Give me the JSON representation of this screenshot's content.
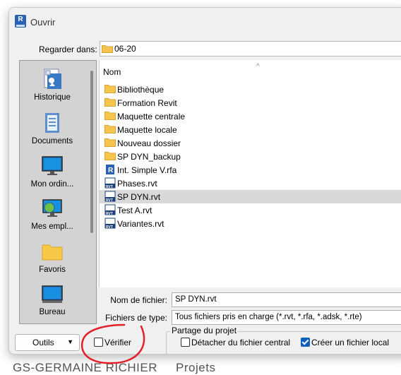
{
  "background": {
    "left_text": "GS-GERMAINE RICHIER",
    "right_text": "Projets"
  },
  "window": {
    "title": "Ouvrir",
    "app_icon_letter": "R"
  },
  "look_in": {
    "label": "Regarder dans:",
    "value": "06-20"
  },
  "places": [
    {
      "label": "Historique",
      "icon": "history-icon"
    },
    {
      "label": "Documents",
      "icon": "documents-icon"
    },
    {
      "label": "Mon ordin...",
      "icon": "computer-icon"
    },
    {
      "label": "Mes empl...",
      "icon": "network-icon"
    },
    {
      "label": "Favoris",
      "icon": "favorites-folder-icon"
    },
    {
      "label": "Bureau",
      "icon": "desktop-icon"
    }
  ],
  "file_list": {
    "column_header": "Nom",
    "items": [
      {
        "name": "Bibliothèque",
        "type": "folder"
      },
      {
        "name": "Formation Revit",
        "type": "folder"
      },
      {
        "name": "Maquette centrale",
        "type": "folder"
      },
      {
        "name": "Maquette locale",
        "type": "folder"
      },
      {
        "name": "Nouveau dossier",
        "type": "folder"
      },
      {
        "name": "SP DYN_backup",
        "type": "folder"
      },
      {
        "name": "Int. Simple V.rfa",
        "type": "rfa"
      },
      {
        "name": "Phases.rvt",
        "type": "rvt"
      },
      {
        "name": "SP DYN.rvt",
        "type": "rvt",
        "selected": true
      },
      {
        "name": "Test A.rvt",
        "type": "rvt"
      },
      {
        "name": "Variantes.rvt",
        "type": "rvt"
      }
    ]
  },
  "filename": {
    "label": "Nom de fichier:",
    "value": "SP DYN.rvt"
  },
  "filetype": {
    "label": "Fichiers de type:",
    "value": "Tous fichiers pris en charge  (*.rvt, *.rfa, *.adsk, *.rte)"
  },
  "tools_button": {
    "label": "Outils"
  },
  "audit": {
    "label": "Vérifier",
    "checked": false
  },
  "worksharing": {
    "title": "Partage du projet",
    "detach": {
      "label": "Détacher du fichier central",
      "checked": false
    },
    "create_local": {
      "label": "Créer un fichier local",
      "checked": true
    }
  },
  "colors": {
    "annotation": "#e0202a",
    "selection": "#d9d9d9",
    "checkbox_accent": "#0b5fbd"
  }
}
